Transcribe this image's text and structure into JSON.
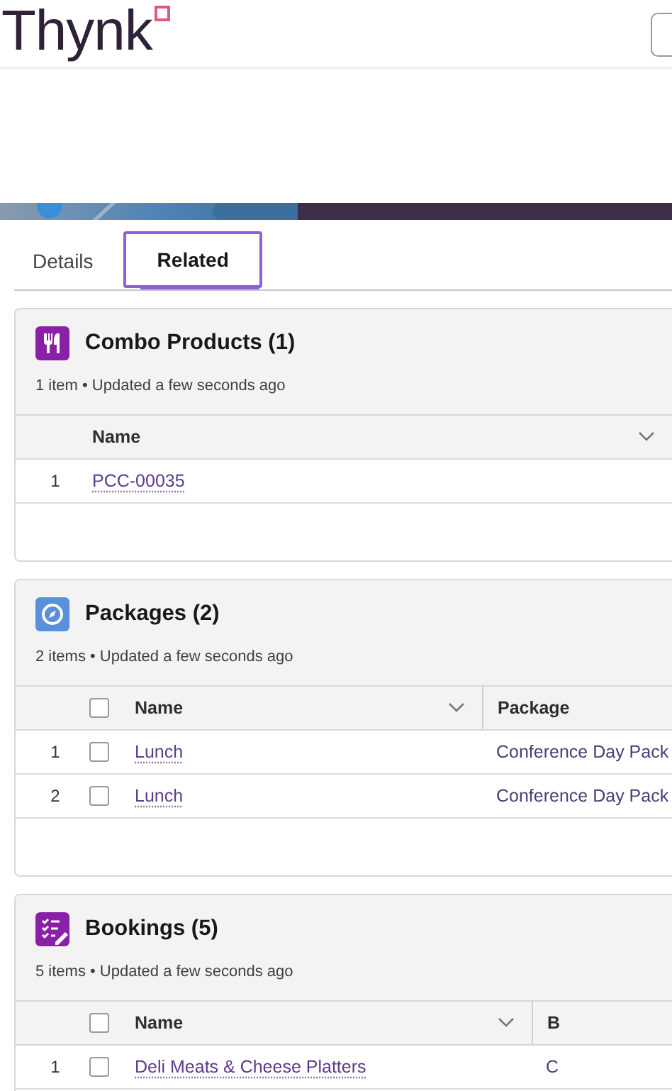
{
  "header": {
    "logo": "Thynk"
  },
  "tabs": [
    {
      "label": "Details",
      "selected": false
    },
    {
      "label": "Related",
      "selected": true
    }
  ],
  "related_lists": [
    {
      "title": "Combo Products (1)",
      "color": "#8a1fa8",
      "meta": "1 item • Updated a few seconds ago",
      "selectable": false,
      "columns": [
        {
          "label": "Name",
          "menu": true
        }
      ],
      "rows": [
        {
          "number": "1",
          "cells": [
            "PCC-00035"
          ]
        }
      ]
    },
    {
      "title": "Packages (2)",
      "color": "#5a8fdc",
      "meta": "2 items • Updated a few seconds ago",
      "selectable": true,
      "select_all_checked": false,
      "columns": [
        {
          "label": "Name",
          "menu": true
        },
        {
          "label": "Package",
          "menu": false
        }
      ],
      "rows": [
        {
          "number": "1",
          "checked": false,
          "cells": [
            "Lunch",
            "Conference Day Pack"
          ]
        },
        {
          "number": "2",
          "checked": false,
          "cells": [
            "Lunch",
            "Conference Day Pack"
          ]
        }
      ]
    },
    {
      "title": "Bookings (5)",
      "color": "#8a1fa8",
      "meta": "5 items • Updated a few seconds ago",
      "selectable": true,
      "select_all_checked": false,
      "columns": [
        {
          "label": "Name",
          "menu": true
        },
        {
          "label": "B",
          "menu": false
        }
      ],
      "rows": [
        {
          "number": "1",
          "checked": false,
          "cells": [
            "Deli Meats & Cheese Platters",
            "C"
          ]
        }
      ]
    }
  ]
}
